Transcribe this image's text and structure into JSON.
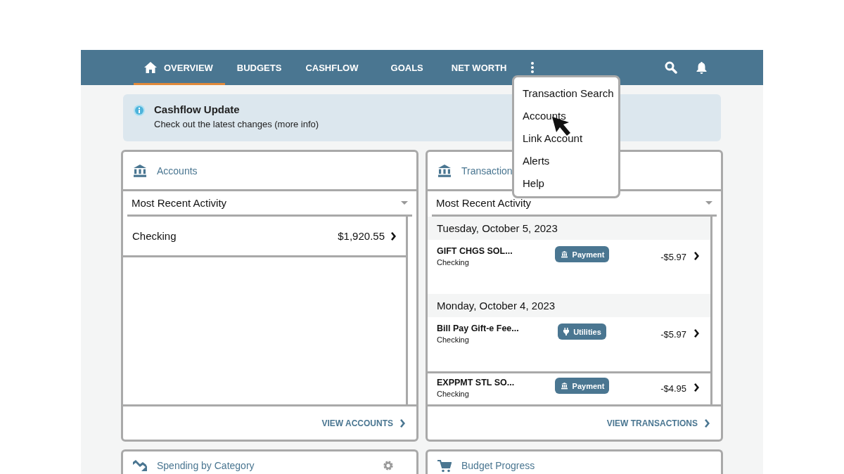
{
  "nav": {
    "tabs": [
      {
        "label": "OVERVIEW",
        "selected": true
      },
      {
        "label": "BUDGETS",
        "selected": false
      },
      {
        "label": "CASHFLOW",
        "selected": false
      },
      {
        "label": "GOALS",
        "selected": false
      },
      {
        "label": "NET WORTH",
        "selected": false
      }
    ]
  },
  "more_menu": {
    "items": [
      "Transaction Search",
      "Accounts",
      "Link Account",
      "Alerts",
      "Help"
    ]
  },
  "banner": {
    "title": "Cashflow Update",
    "text": "Check out the latest changes (more info)"
  },
  "accounts_card": {
    "title": "Accounts",
    "sort": "Most Recent Activity",
    "rows": [
      {
        "name": "Checking",
        "amount": "$1,920.55"
      }
    ],
    "footer_link": "VIEW ACCOUNTS"
  },
  "transactions_card": {
    "title": "Transaction",
    "sort": "Most Recent Activity",
    "groups": [
      {
        "date": "Tuesday, October 5, 2023",
        "items": [
          {
            "name": "GIFT CHGS  SOL...",
            "account": "Checking",
            "category": "Payment",
            "kind": "payment",
            "amount": "-$5.97"
          }
        ]
      },
      {
        "date": "Monday, October 4, 2023",
        "items": [
          {
            "name": "Bill Pay Gift-e Fee...",
            "account": "Checking",
            "category": "Utilities",
            "kind": "utilities",
            "amount": "-$5.97"
          },
          {
            "name": "EXPPMT STL  SO...",
            "account": "Checking",
            "category": "Payment",
            "kind": "payment",
            "amount": "-$4.95"
          }
        ]
      }
    ],
    "footer_link": "VIEW TRANSACTIONS"
  },
  "bottom_cards": [
    {
      "title": "Spending by Category"
    },
    {
      "title": "Budget Progress"
    }
  ]
}
